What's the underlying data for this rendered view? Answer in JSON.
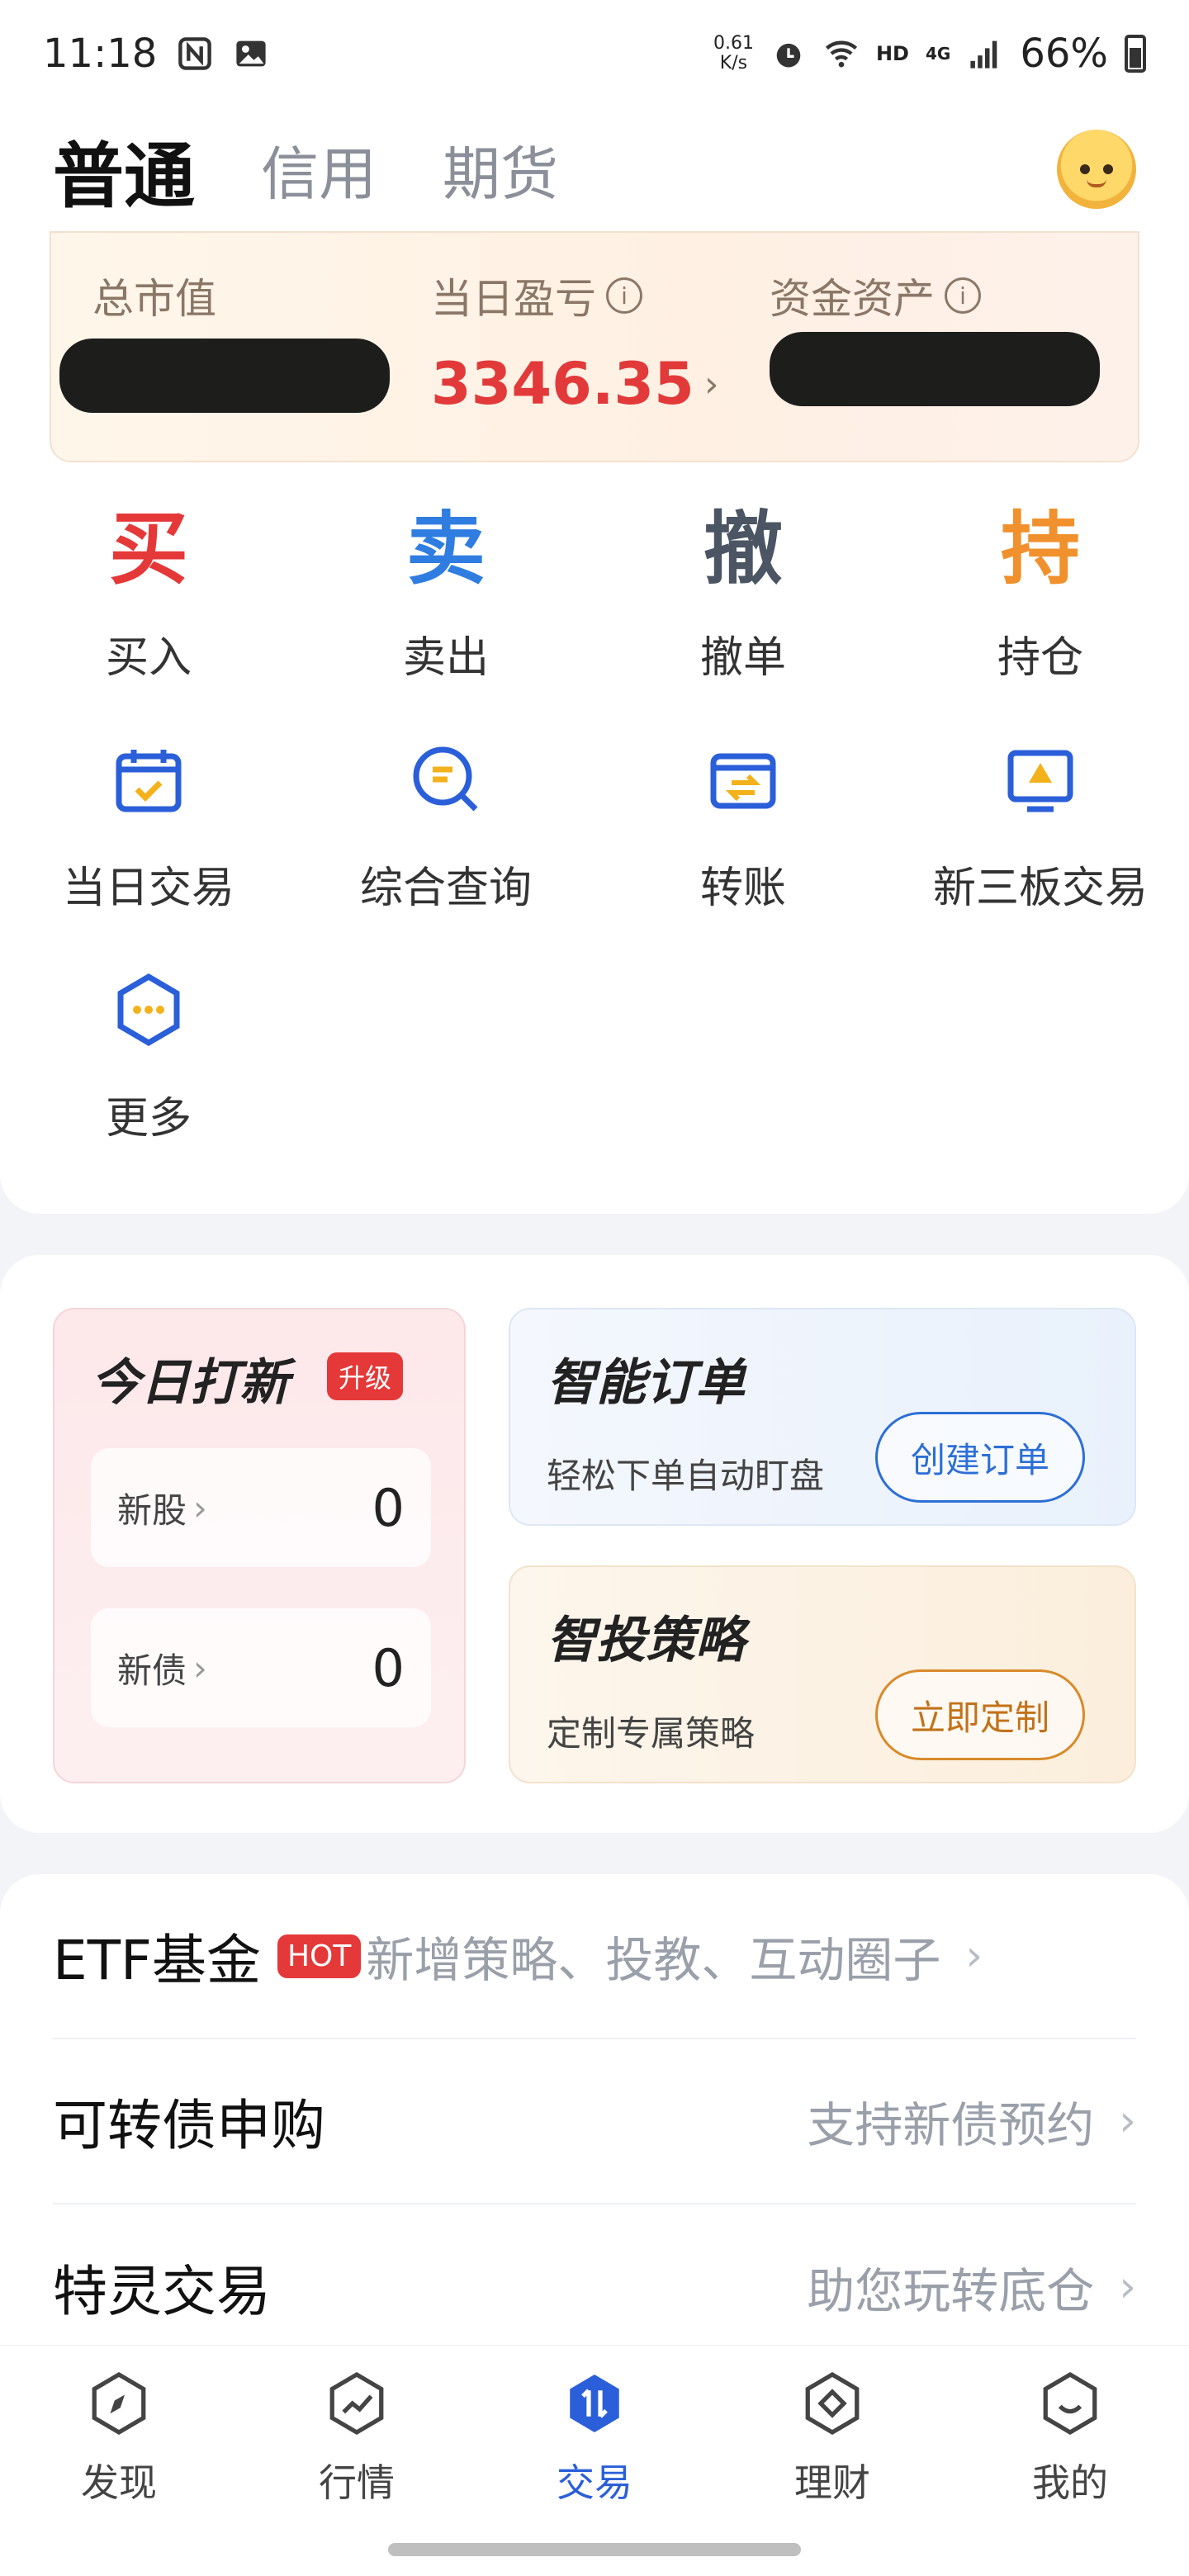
{
  "status_bar": {
    "time": "11:18",
    "net_speed_top": "0.61",
    "net_speed_bottom": "K/s",
    "hd": "HD",
    "network": "4G",
    "battery": "66%"
  },
  "header": {
    "tabs": [
      {
        "label": "普通",
        "active": true
      },
      {
        "label": "信用",
        "active": false
      },
      {
        "label": "期货",
        "active": false
      }
    ],
    "avatar_icon": "mascot-icon"
  },
  "assets": {
    "total_label": "总市值",
    "daily_pl_label": "当日盈亏",
    "daily_pl_value": "3346.35",
    "funds_label": "资金资产"
  },
  "actions_primary": [
    {
      "char": "买",
      "label": "买入",
      "color": "#e53838"
    },
    {
      "char": "卖",
      "label": "卖出",
      "color": "#2f7de1"
    },
    {
      "char": "撤",
      "label": "撤单",
      "color": "#4b5563"
    },
    {
      "char": "持",
      "label": "持仓",
      "color": "#f0912d"
    }
  ],
  "actions_secondary": [
    {
      "label": "当日交易",
      "icon": "calendar-check-icon"
    },
    {
      "label": "综合查询",
      "icon": "search-doc-icon"
    },
    {
      "label": "转账",
      "icon": "transfer-icon"
    },
    {
      "label": "新三板交易",
      "icon": "board-icon"
    }
  ],
  "more": {
    "label": "更多",
    "icon": "more-hexagon-icon"
  },
  "promo": {
    "ipo": {
      "title": "今日打新",
      "badge": "升级",
      "stock_label": "新股",
      "stock_value": "0",
      "bond_label": "新债",
      "bond_value": "0"
    },
    "smart_order": {
      "title": "智能订单",
      "subtitle": "轻松下单自动盯盘",
      "button": "创建订单"
    },
    "strategy": {
      "title": "智投策略",
      "subtitle": "定制专属策略",
      "button": "立即定制"
    }
  },
  "list": [
    {
      "title": "ETF基金",
      "badge": "HOT",
      "desc": "新增策略、投教、互动圈子"
    },
    {
      "title": "可转债申购",
      "desc": "支持新债预约"
    },
    {
      "title": "特灵交易",
      "desc": "助您玩转底仓"
    }
  ],
  "bottom_nav": [
    {
      "label": "发现",
      "icon": "compass-icon"
    },
    {
      "label": "行情",
      "icon": "chart-icon"
    },
    {
      "label": "交易",
      "icon": "trade-icon",
      "active": true
    },
    {
      "label": "理财",
      "icon": "finance-icon"
    },
    {
      "label": "我的",
      "icon": "profile-icon"
    }
  ],
  "colors": {
    "accent": "#2b5fd9",
    "red": "#e23a3a",
    "orange": "#f0912d"
  }
}
